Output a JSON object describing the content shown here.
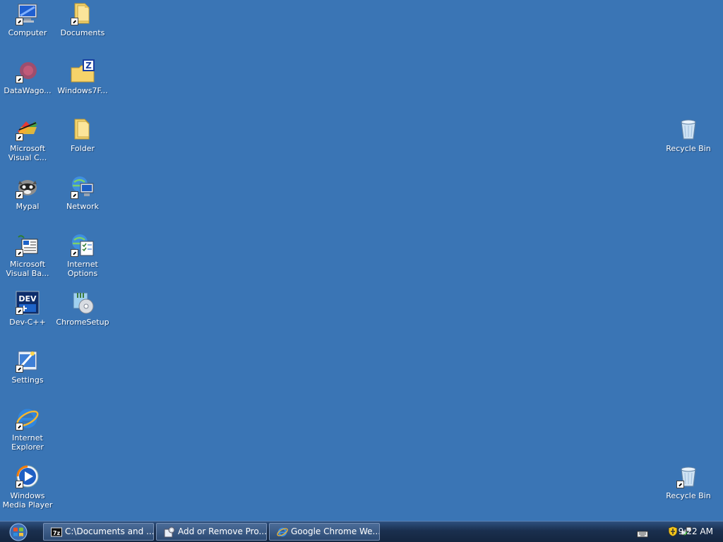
{
  "desktop": {
    "background": "#3a75b5",
    "icons": [
      {
        "name": "computer",
        "label": "Computer",
        "icon": "monitor-icon",
        "shortcut": true
      },
      {
        "name": "documents",
        "label": "Documents",
        "icon": "folder-icon",
        "shortcut": true
      },
      {
        "name": "datawagon",
        "label": "DataWago...",
        "icon": "red-blob-icon",
        "shortcut": true
      },
      {
        "name": "windows7f",
        "label": "Windows7F...",
        "icon": "zip-folder-icon",
        "shortcut": false
      },
      {
        "name": "microsoft-visual-c",
        "label": "Microsoft\nVisual C...",
        "icon": "visual-studio-icon",
        "shortcut": true
      },
      {
        "name": "folder",
        "label": "Folder",
        "icon": "folder-icon",
        "shortcut": false
      },
      {
        "name": "mypal",
        "label": "Mypal",
        "icon": "raccoon-icon",
        "shortcut": true
      },
      {
        "name": "network",
        "label": "Network",
        "icon": "network-icon",
        "shortcut": true
      },
      {
        "name": "microsoft-visual-basic",
        "label": "Microsoft\nVisual Ba...",
        "icon": "visual-basic-icon",
        "shortcut": true
      },
      {
        "name": "internet-options",
        "label": "Internet\nOptions",
        "icon": "internet-options-icon",
        "shortcut": true
      },
      {
        "name": "dev-cpp",
        "label": "Dev-C++",
        "icon": "dev-cpp-icon",
        "shortcut": true
      },
      {
        "name": "chromesetup",
        "label": "ChromeSetup",
        "icon": "installer-icon",
        "shortcut": false
      },
      {
        "name": "settings",
        "label": "Settings",
        "icon": "settings-icon",
        "shortcut": true
      },
      {
        "name": "internet-explorer",
        "label": "Internet\nExplorer",
        "icon": "ie-icon",
        "shortcut": true
      },
      {
        "name": "windows-media-player",
        "label": "Windows\nMedia Player",
        "icon": "media-player-icon",
        "shortcut": true
      },
      {
        "name": "recycle-bin",
        "label": "Recycle Bin",
        "icon": "recycle-bin-icon",
        "shortcut": false
      },
      {
        "name": "recycle-bin-shortcut",
        "label": "Recycle Bin",
        "icon": "recycle-bin-icon",
        "shortcut": true
      }
    ]
  },
  "taskbar": {
    "buttons": [
      {
        "label": "C:\\Documents and ...",
        "icon": "7zip-icon"
      },
      {
        "label": "Add or Remove Pro...",
        "icon": "add-remove-programs-icon"
      },
      {
        "label": "Google Chrome We...",
        "icon": "ie-icon"
      }
    ],
    "tray": {
      "icons": [
        "keyboard-icon",
        "security-shield-icon",
        "network-status-icon"
      ],
      "clock": "9:22 AM"
    }
  }
}
